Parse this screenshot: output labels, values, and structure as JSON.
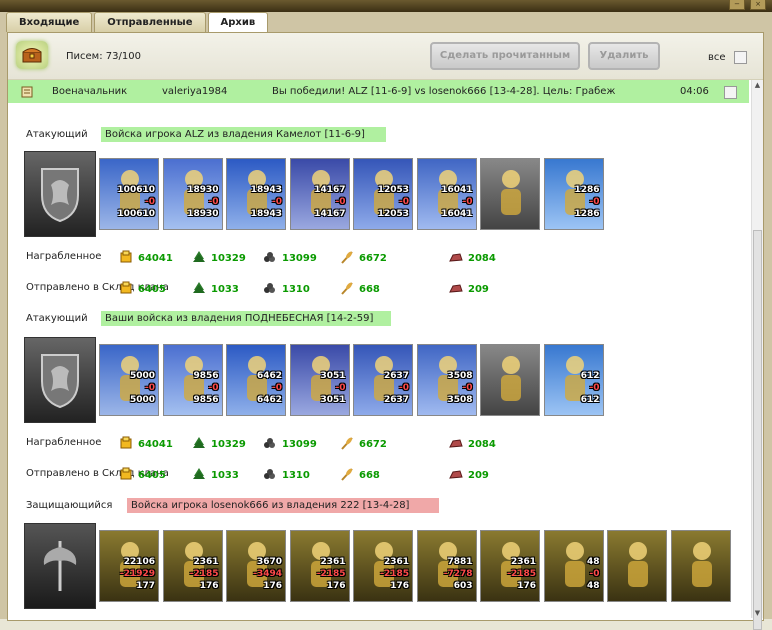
{
  "tabs": [
    "Входящие",
    "Отправленные",
    "Архив"
  ],
  "active_tab": "Архив",
  "toolbar": {
    "letters": "Писем: 73/100",
    "mark_read": "Сделать прочитанным",
    "delete": "Удалить",
    "all": "все"
  },
  "message": {
    "from": "Военачальник",
    "user": "valeriya1984",
    "subject": "Вы победили! ALZ [11-6-9] vs losenok666 [13-4-28]. Цель: Грабеж",
    "time": "04:06"
  },
  "labels": {
    "attacker": "Атакующий",
    "defender": "Защищающийся",
    "looted": "Награбленное",
    "sent": "Отправлено в Склад клана"
  },
  "sections": [
    {
      "title": "Войска игрока ALZ из владения Камелот [11-6-9]",
      "units": [
        {
          "top": "100610",
          "loss": "-0",
          "bottom": "100610"
        },
        {
          "top": "18930",
          "loss": "-0",
          "bottom": "18930"
        },
        {
          "top": "18943",
          "loss": "-0",
          "bottom": "18943"
        },
        {
          "top": "14167",
          "loss": "-0",
          "bottom": "14167"
        },
        {
          "top": "12053",
          "loss": "-0",
          "bottom": "12053"
        },
        {
          "top": "16041",
          "loss": "-0",
          "bottom": "16041"
        },
        {
          "top": "",
          "loss": "",
          "bottom": ""
        },
        {
          "top": "1286",
          "loss": "-0",
          "bottom": "1286"
        }
      ],
      "looted": [
        "64041",
        "10329",
        "13099",
        "6672",
        "2084"
      ],
      "sent": [
        "6405",
        "1033",
        "1310",
        "668",
        "209"
      ]
    },
    {
      "title": "Ваши войска из владения ПОДНЕБЕСНАЯ [14-2-59]",
      "units": [
        {
          "top": "5000",
          "loss": "-0",
          "bottom": "5000"
        },
        {
          "top": "9856",
          "loss": "-0",
          "bottom": "9856"
        },
        {
          "top": "6462",
          "loss": "-0",
          "bottom": "6462"
        },
        {
          "top": "3051",
          "loss": "-0",
          "bottom": "3051"
        },
        {
          "top": "2637",
          "loss": "-0",
          "bottom": "2637"
        },
        {
          "top": "3508",
          "loss": "-0",
          "bottom": "3508"
        },
        {
          "top": "",
          "loss": "",
          "bottom": ""
        },
        {
          "top": "612",
          "loss": "-0",
          "bottom": "612"
        }
      ],
      "looted": [
        "64041",
        "10329",
        "13099",
        "6672",
        "2084"
      ],
      "sent": [
        "6405",
        "1033",
        "1310",
        "668",
        "209"
      ]
    },
    {
      "title": "Войска игрока losenok666 из владения 222 [13-4-28]",
      "units": [
        {
          "top": "22106",
          "loss": "-21929",
          "bottom": "177"
        },
        {
          "top": "2361",
          "loss": "-2185",
          "bottom": "176"
        },
        {
          "top": "3670",
          "loss": "-3494",
          "bottom": "176"
        },
        {
          "top": "2361",
          "loss": "-2185",
          "bottom": "176"
        },
        {
          "top": "2361",
          "loss": "-2185",
          "bottom": "176"
        },
        {
          "top": "7881",
          "loss": "-7278",
          "bottom": "603"
        },
        {
          "top": "2361",
          "loss": "-2185",
          "bottom": "176"
        },
        {
          "top": "48",
          "loss": "-0",
          "bottom": "48"
        },
        {
          "top": "",
          "loss": "",
          "bottom": ""
        },
        {
          "top": "",
          "loss": "",
          "bottom": ""
        }
      ]
    }
  ],
  "resource_icons": [
    "gold-icon",
    "wood-icon",
    "ore-icon",
    "grain-icon",
    "stone-icon"
  ],
  "colors": {
    "highlight_green": "#b0f0a0",
    "highlight_red": "#f0a8a8",
    "resource_text": "#0a9a00"
  }
}
